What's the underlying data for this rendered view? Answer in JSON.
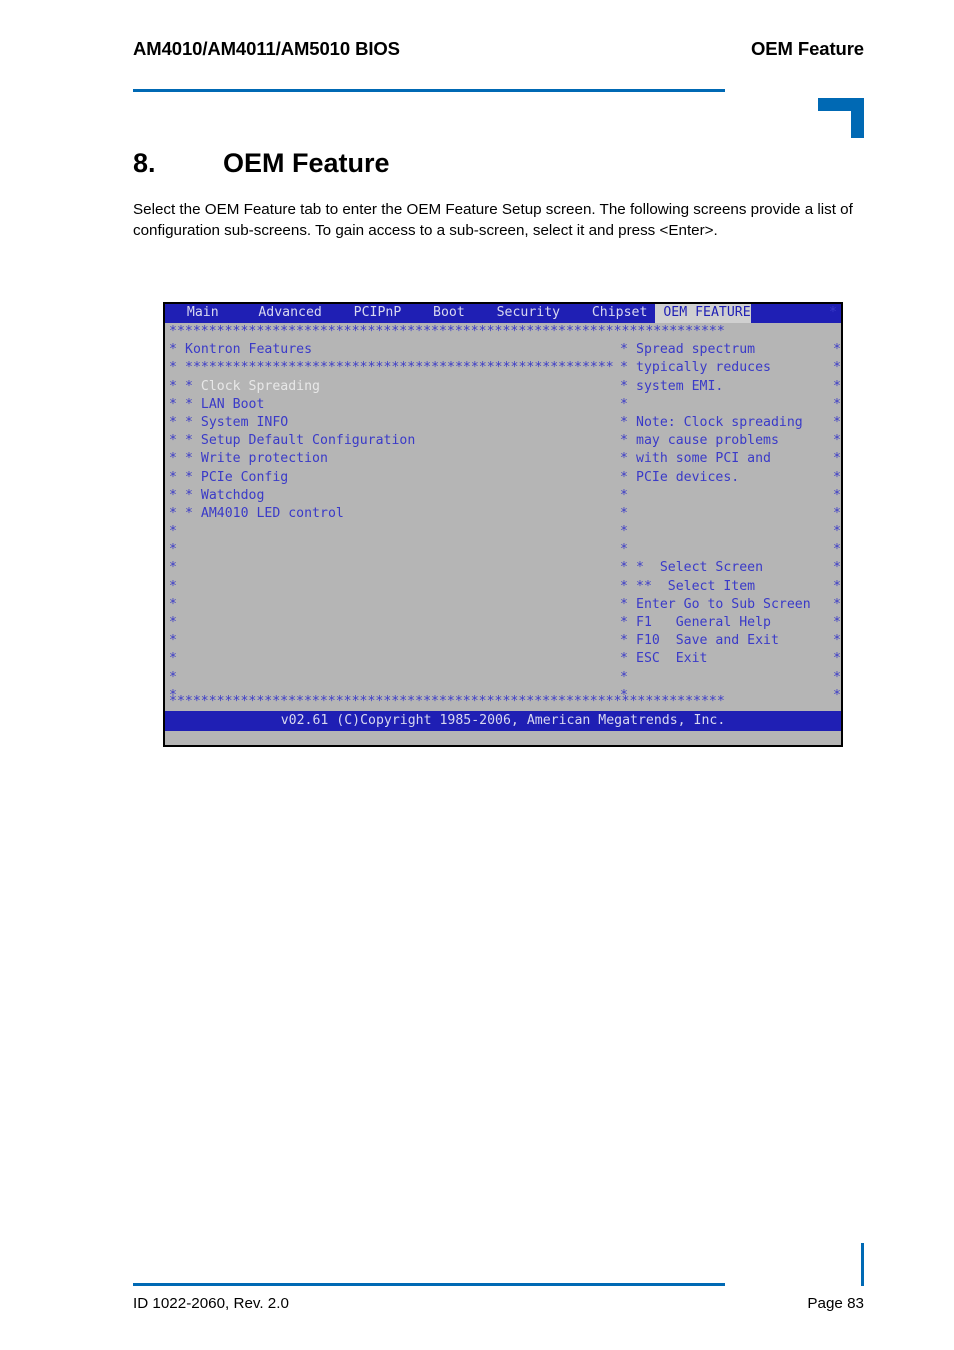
{
  "header": {
    "left": "AM4010/AM4011/AM5010 BIOS",
    "right": "OEM Feature"
  },
  "section": {
    "number": "8.",
    "title": "OEM Feature"
  },
  "intro": "Select the OEM Feature tab to enter the OEM Feature Setup screen. The following screens provide a list of configuration sub-screens. To gain access to a sub-screen, select it and press <Enter>.",
  "bios": {
    "tabs": [
      {
        "label": "  Main  ",
        "active": false
      },
      {
        "label": "   Advanced  ",
        "active": false
      },
      {
        "label": "  PCIPnP  ",
        "active": false
      },
      {
        "label": "  Boot  ",
        "active": false
      },
      {
        "label": "  Security  ",
        "active": false
      },
      {
        "label": "  Chipset ",
        "active": false
      },
      {
        "label": " OEM FEATURE",
        "active": true
      }
    ],
    "menubar_trail": "*",
    "top_rule": "**********************************************************************",
    "group_title": "Kontron Features",
    "group_rule": "******************************************************",
    "menu_items": [
      {
        "label": "Clock Spreading",
        "selected": true
      },
      {
        "label": "LAN Boot",
        "selected": false
      },
      {
        "label": "System INFO",
        "selected": false
      },
      {
        "label": "Setup Default Configuration",
        "selected": false
      },
      {
        "label": "Write protection",
        "selected": false
      },
      {
        "label": "PCIe Config",
        "selected": false
      },
      {
        "label": "Watchdog",
        "selected": false
      },
      {
        "label": "AM4010 LED control",
        "selected": false
      }
    ],
    "help_lines": [
      "Spread spectrum",
      "typically reduces",
      "system EMI.",
      "",
      "Note: Clock spreading",
      "may cause problems",
      "with some PCI and",
      "PCIe devices.",
      "",
      "",
      ""
    ],
    "nav_keys": [
      {
        "key": "*",
        "desc": "  Select Screen"
      },
      {
        "key": "**",
        "desc": "  Select Item"
      },
      {
        "key": "Enter",
        "desc": "Go to Sub Screen"
      },
      {
        "key": "F1",
        "desc": "   General Help"
      },
      {
        "key": "F10",
        "desc": "  Save and Exit"
      },
      {
        "key": "ESC",
        "desc": "  Exit"
      }
    ],
    "bottom_rule": "**********************************************************************",
    "footer": "v02.61 (C)Copyright 1985-2006, American Megatrends, Inc.",
    "star": "*"
  },
  "footer": {
    "left": "ID 1022-2060, Rev. 2.0",
    "right": "Page 83"
  },
  "colors": {
    "accent_blue": "#0069b4",
    "bios_blue": "#1f1fb4",
    "bios_text": "#3a3ac8",
    "bios_bg": "#b5b5b5",
    "bios_selected": "#e8e8e8"
  }
}
